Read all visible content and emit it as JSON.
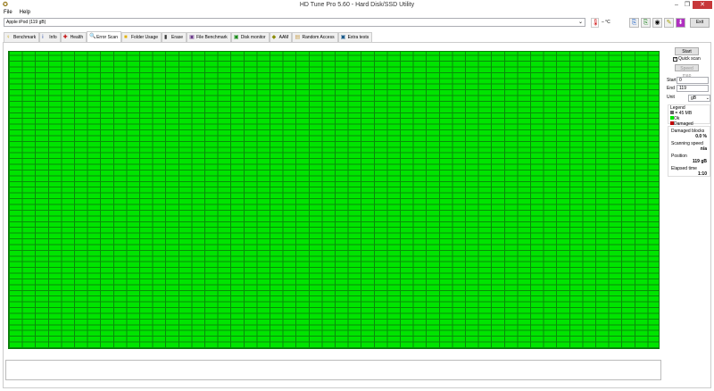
{
  "window": {
    "title": "HD Tune Pro 5.60 - Hard Disk/SSD Utility",
    "minimize": "–",
    "maximize": "❐",
    "close": "✕"
  },
  "menu": [
    "File",
    "Help"
  ],
  "drive": {
    "selected": "Apple  iPod (119 gB)"
  },
  "temperature": "– °C",
  "toolbar": {
    "exit": "Exit"
  },
  "tabs": [
    {
      "label": "Benchmark",
      "icon": "benchmark-icon",
      "glyph": "♀",
      "color": "#c9a000"
    },
    {
      "label": "Info",
      "icon": "info-icon",
      "glyph": "i",
      "color": "#1a3c9c"
    },
    {
      "label": "Health",
      "icon": "health-icon",
      "glyph": "✚",
      "color": "#c00000"
    },
    {
      "label": "Error Scan",
      "icon": "error-scan-icon",
      "glyph": "🔍",
      "color": "#1a8a1a",
      "active": true
    },
    {
      "label": "Folder Usage",
      "icon": "folder-icon",
      "glyph": "■",
      "color": "#e0b000"
    },
    {
      "label": "Erase",
      "icon": "trash-icon",
      "glyph": "▮",
      "color": "#333"
    },
    {
      "label": "File Benchmark",
      "icon": "file-benchmark-icon",
      "glyph": "▣",
      "color": "#6a3a8a"
    },
    {
      "label": "Disk monitor",
      "icon": "disk-monitor-icon",
      "glyph": "▣",
      "color": "#1a8a1a"
    },
    {
      "label": "AAM",
      "icon": "aam-icon",
      "glyph": "◆",
      "color": "#8a8a00"
    },
    {
      "label": "Random Access",
      "icon": "random-access-icon",
      "glyph": "▤",
      "color": "#c9a050"
    },
    {
      "label": "Extra tests",
      "icon": "extra-tests-icon",
      "glyph": "▣",
      "color": "#1a5a8a"
    }
  ],
  "side": {
    "start_button": "Start",
    "quick_scan": "Quick scan",
    "quick_scan_checked": true,
    "speed_map": "Speed map",
    "start_label": "Start",
    "start_value": "0",
    "end_label": "End",
    "end_value": "119",
    "unit_label": "Unit",
    "unit_value": "gB",
    "legend_title": "Legend",
    "legend_block": "= 45 MB",
    "legend_ok": "Ok",
    "legend_damaged": "Damaged",
    "damaged_label": "Damaged blocks",
    "damaged_value": "0.0 %",
    "speed_label": "Scanning speed",
    "speed_value": "n/a",
    "position_label": "Position",
    "position_value": "119 gB",
    "elapsed_label": "Elapsed time",
    "elapsed_value": "1:10"
  },
  "colors": {
    "ok": "#00e400",
    "damaged": "#c00000",
    "grid_line": "#0a8a0a"
  }
}
